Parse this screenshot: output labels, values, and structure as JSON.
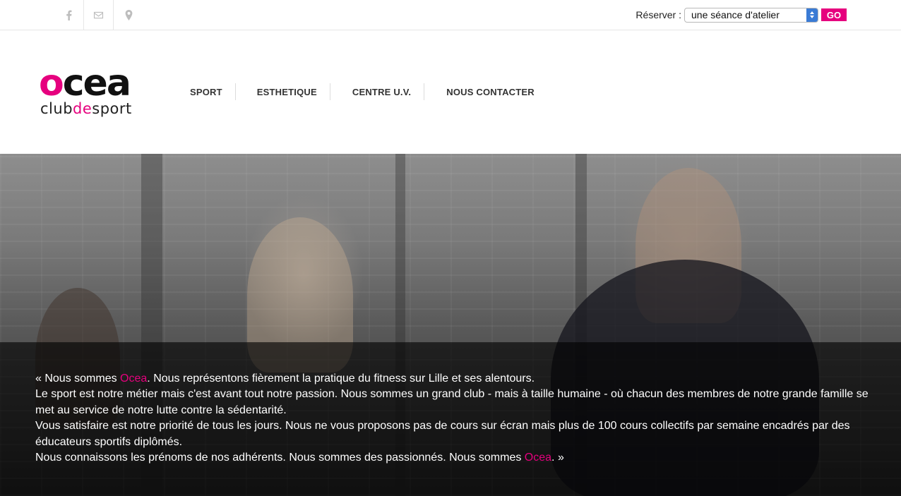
{
  "topbar": {
    "social_icons": [
      "facebook-icon",
      "mail-icon",
      "location-pin-icon"
    ],
    "reserve_label": "Réserver :",
    "reserve_select_value": "une séance d'atelier",
    "go_label": "GO"
  },
  "brand": {
    "logo_o": "o",
    "logo_rest": "cea",
    "tag_part1": "club",
    "tag_part2": "de",
    "tag_part3": "sport"
  },
  "nav": {
    "items": [
      {
        "label": "SPORT"
      },
      {
        "label": "ESTHETIQUE"
      },
      {
        "label": "CENTRE U.V."
      },
      {
        "label": "NOUS CONTACTER"
      }
    ]
  },
  "hero": {
    "line1_a": "« Nous sommes ",
    "line1_brand": "Ocea",
    "line1_b": ". Nous représentons fièrement la pratique du fitness sur Lille et ses alentours.",
    "line2": "Le sport est notre métier mais c'est avant tout notre passion. Nous sommes un grand club - mais à taille humaine - où chacun des membres de notre grande famille se met au service de notre lutte contre la sédentarité.",
    "line3": "Vous satisfaire est notre priorité de tous les jours. Nous ne vous proposons pas de cours sur écran mais plus de 100 cours collectifs par semaine encadrés par des éducateurs sportifs diplômés.",
    "line4_a": "Nous connaissons les prénoms de nos adhérents. Nous sommes des passionnés. Nous sommes ",
    "line4_brand": "Ocea",
    "line4_b": ". »"
  },
  "colors": {
    "accent": "#e6007e",
    "select_arrow": "#3a7bd5"
  }
}
